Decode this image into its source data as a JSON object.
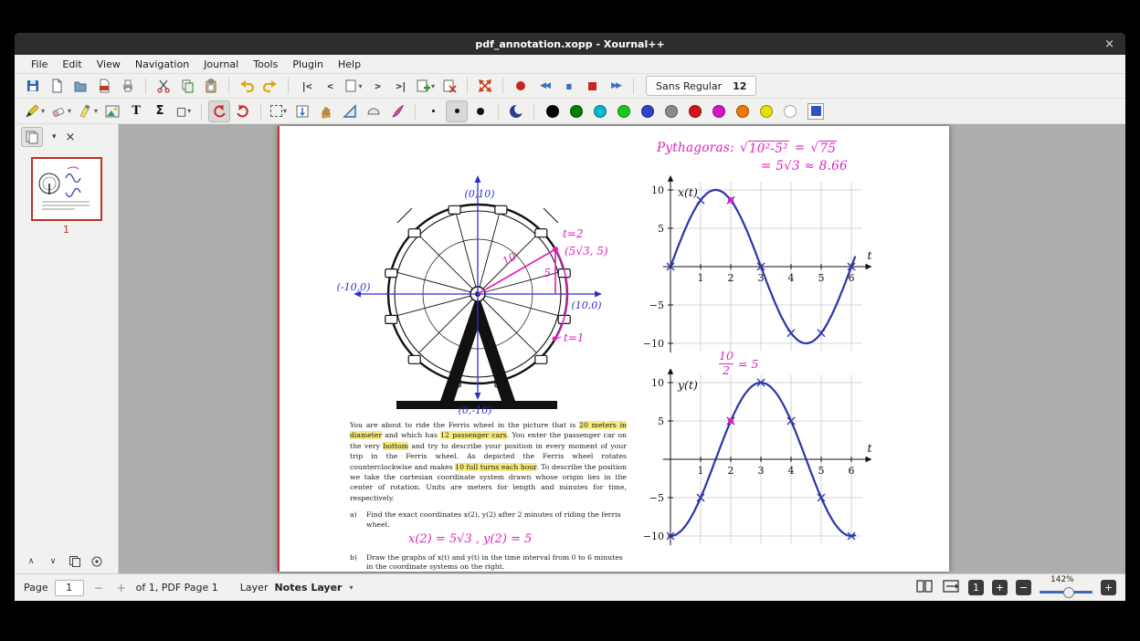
{
  "window": {
    "title": "pdf_annotation.xopp - Xournal++",
    "close_label": "×"
  },
  "menu": {
    "items": [
      "File",
      "Edit",
      "View",
      "Navigation",
      "Journal",
      "Tools",
      "Plugin",
      "Help"
    ]
  },
  "toolbar": {
    "font_family": "Sans Regular",
    "font_size": "12"
  },
  "icons": {
    "dropdown": "▾",
    "close": "×",
    "first_page": "|<",
    "prev_page": "<",
    "next_page": ">",
    "last_page": ">|",
    "record": "●",
    "rewind": "◀◀",
    "pause": "▮▮",
    "stop": "■",
    "forward": "▶▶",
    "text_tool": "T",
    "math_tool": "Σ",
    "shape_tool": "□",
    "sidebar_up": "∧",
    "sidebar_down": "∨"
  },
  "colors": {
    "swatches": [
      "#000000",
      "#007f00",
      "#00b8c8",
      "#19c819",
      "#2d43c8",
      "#8a8a8a",
      "#d01616",
      "#d016c8",
      "#f07800",
      "#e8e000",
      "#ffffff"
    ],
    "picker": "#3050c8"
  },
  "sidebar": {
    "page_thumb_label": "1"
  },
  "page": {
    "axis_labels": {
      "top": "(0,10)",
      "left": "(-10,0)",
      "right": "(10,0)",
      "bottom": "(0,-10)"
    },
    "annotations": {
      "radius_label": "10",
      "height_label": "5",
      "t2_label": "t=2",
      "point_label": "(5√3, 5)",
      "t1_label": "t=1",
      "pyth_label": "Pythagoras:",
      "pyth_rad1": "10²-5²",
      "pyth_eq": "=",
      "pyth_rad2": "75",
      "pyth_line2": "= 5√3 ≈ 8.66",
      "frac_num": "10",
      "frac_den": "2",
      "frac_rhs": "= 5",
      "answer": "x(2) = 5√3 ,  y(2) = 5"
    },
    "paragraph": {
      "segments": [
        {
          "t": "You are about to ride the Ferris wheel in the picture that is ",
          "h": false
        },
        {
          "t": "20 meters in diameter",
          "h": true
        },
        {
          "t": " and which has ",
          "h": false
        },
        {
          "t": "12 passenger cars",
          "h": true
        },
        {
          "t": ".  You enter the passenger car on the very ",
          "h": false
        },
        {
          "t": "bottom",
          "h": true
        },
        {
          "t": " and try to describe your position in every moment of your trip in the Ferris wheel. As depicted the Ferris wheel rotates counterclockwise and makes ",
          "h": false
        },
        {
          "t": "10 full turns each hour",
          "h": true
        },
        {
          "t": ". To describe the position we take the cartesian coordinate system drawn whose origin lies in the center of rotation. Units are meters for length and minutes for time, respectively.",
          "h": false
        }
      ]
    },
    "items": [
      {
        "label": "a)",
        "text": "Find the exact coordinates x(2), y(2) after 2 minutes of riding the ferris wheel."
      },
      {
        "label": "b)",
        "text": "Draw the graphs of x(t) and y(t) in the time interval from 0 to 6 minutes in the coordinate systems on the right."
      }
    ]
  },
  "chart_data": [
    {
      "type": "line",
      "title": "x(t)",
      "curve_label": "x(t)",
      "axis_label": "t",
      "x_ticks": [
        1,
        2,
        3,
        4,
        5,
        6
      ],
      "y_ticks": [
        10,
        5,
        -5,
        -10
      ],
      "xlim": [
        0,
        6.3
      ],
      "ylim": [
        -11,
        11
      ],
      "form": "sin",
      "amplitude": 10,
      "period": 6,
      "t_end": 6.15,
      "marks_t": [
        0,
        1,
        2,
        3,
        4,
        5,
        6
      ],
      "highlight_point": {
        "t": 2,
        "value": 8.66
      },
      "color": "#2b35a8",
      "highlight_color": "#e01ec0",
      "grid": true
    },
    {
      "type": "line",
      "title": "y(t)",
      "curve_label": "y(t)",
      "axis_label": "t",
      "x_ticks": [
        1,
        2,
        3,
        4,
        5,
        6
      ],
      "y_ticks": [
        10,
        5,
        -5,
        -10
      ],
      "xlim": [
        0,
        6.3
      ],
      "ylim": [
        -11,
        11
      ],
      "form": "neg_cos",
      "amplitude": 10,
      "period": 6,
      "t_end": 6.15,
      "marks_t": [
        0,
        1,
        2,
        3,
        4,
        5,
        6
      ],
      "highlight_point": {
        "t": 2,
        "value": 5
      },
      "color": "#2b35a8",
      "highlight_color": "#e01ec0",
      "grid": true
    }
  ],
  "statusbar": {
    "page_label": "Page",
    "page_value": "1",
    "decrement": "−",
    "increment": "+",
    "page_info": "of 1, PDF Page 1",
    "layer_label": "Layer",
    "layer_name": "Notes Layer",
    "zoom_percent": "142%",
    "zoom_badge": "1",
    "zoom_in": "+",
    "zoom_out": "−",
    "zoom_fit": "+"
  }
}
